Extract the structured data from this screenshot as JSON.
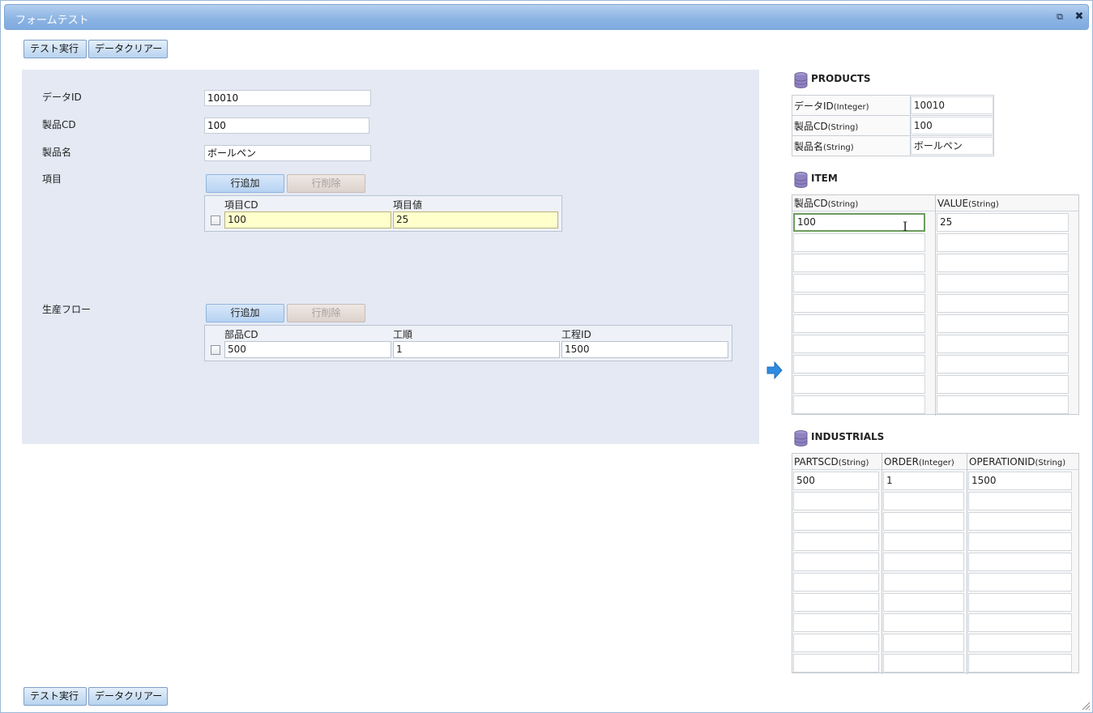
{
  "window": {
    "title": "フォームテスト",
    "popout_icon": "popout-icon",
    "close_icon": "close-icon"
  },
  "toolbar": {
    "run_label": "テスト実行",
    "clear_label": "データクリアー"
  },
  "form": {
    "data_id": {
      "label": "データID",
      "value": "10010"
    },
    "product_cd": {
      "label": "製品CD",
      "value": "100"
    },
    "product_name": {
      "label": "製品名",
      "value": "ボールペン"
    },
    "items": {
      "label": "項目",
      "add_label": "行追加",
      "delete_label": "行削除",
      "columns": [
        "項目CD",
        "項目値"
      ],
      "rows": [
        {
          "cd": "100",
          "value": "25"
        }
      ]
    },
    "flow": {
      "label": "生産フロー",
      "add_label": "行追加",
      "delete_label": "行削除",
      "columns": [
        "部品CD",
        "工順",
        "工程ID"
      ],
      "rows": [
        {
          "part": "500",
          "order": "1",
          "op": "1500"
        }
      ]
    }
  },
  "products": {
    "title": "PRODUCTS",
    "rows": [
      {
        "key": "データID",
        "type": "(Integer)",
        "value": "10010"
      },
      {
        "key": "製品CD",
        "type": "(String)",
        "value": "100"
      },
      {
        "key": "製品名",
        "type": "(String)",
        "value": "ボールペン"
      }
    ]
  },
  "item": {
    "title": "ITEM",
    "columns": [
      {
        "name": "製品CD",
        "type": "(String)"
      },
      {
        "name": "VALUE",
        "type": "(String)"
      }
    ],
    "rows": [
      [
        "100",
        "25"
      ]
    ]
  },
  "industrials": {
    "title": "INDUSTRIALS",
    "columns": [
      {
        "name": "PARTSCD",
        "type": "(String)"
      },
      {
        "name": "ORDER",
        "type": "(Integer)"
      },
      {
        "name": "OPERATIONID",
        "type": "(String)"
      }
    ],
    "rows": [
      [
        "500",
        "1",
        "1500"
      ]
    ]
  }
}
